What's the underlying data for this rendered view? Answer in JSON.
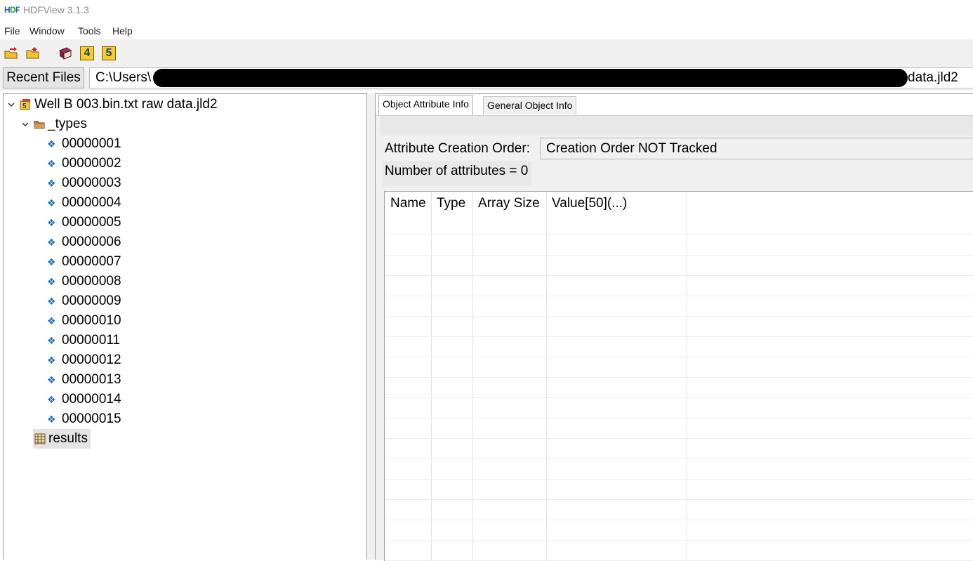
{
  "window": {
    "title": "HDFView 3.1.3",
    "logo_icon": "hdf-logo-icon"
  },
  "menubar": {
    "items": [
      "File",
      "Window",
      "Tools",
      "Help"
    ]
  },
  "toolbar": {
    "icons": [
      "open-file-icon",
      "open-folder-icon",
      "book-icon",
      "hdf4-icon",
      "hdf5-icon"
    ],
    "hdf4_label": "4",
    "hdf5_label": "5"
  },
  "pathbar": {
    "recent_label": "Recent Files",
    "path_prefix": "C:\\Users\\",
    "path_suffix": "data.jld2"
  },
  "tree": {
    "root": "Well B 003.bin.txt raw data.jld2",
    "group": "_types",
    "types": [
      "00000001",
      "00000002",
      "00000003",
      "00000004",
      "00000005",
      "00000006",
      "00000007",
      "00000008",
      "00000009",
      "00000010",
      "00000011",
      "00000012",
      "00000013",
      "00000014",
      "00000015"
    ],
    "dataset": "results"
  },
  "tabs": [
    "Object Attribute Info",
    "General Object Info"
  ],
  "attributes": {
    "creation_order_label": "Attribute Creation Order:",
    "creation_order_value": "Creation Order NOT Tracked",
    "count_label": "Number of attributes = 0",
    "columns": [
      "Name",
      "Type",
      "Array Size",
      "Value[50](...)"
    ]
  }
}
